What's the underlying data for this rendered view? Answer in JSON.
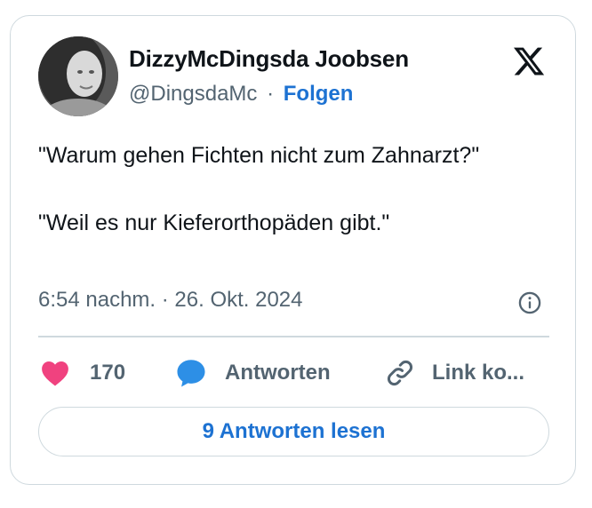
{
  "author": {
    "display_name": "DizzyMcDingsda Joobsen",
    "handle": "@DingsdaMc",
    "separator": "·",
    "follow_label": "Folgen"
  },
  "tweet": {
    "text": "\"Warum gehen Fichten nicht zum Zahnarzt?\"\n\n\"Weil es nur Kieferorthopäden gibt.\"",
    "timestamp": "6:54 nachm. · 26. Okt. 2024"
  },
  "actions": {
    "like_count": "170",
    "reply_label": "Antworten",
    "link_label": "Link ko..."
  },
  "read_replies_label": "9 Antworten lesen",
  "icons": {
    "brand": "x-logo-icon",
    "info": "info-icon",
    "like": "heart-icon",
    "reply": "speech-bubble-icon",
    "link": "link-icon"
  },
  "colors": {
    "accent": "#1d72d2",
    "like": "#f0427f",
    "reply": "#2d8fe6",
    "muted": "#536471",
    "border": "#cfd9de"
  }
}
